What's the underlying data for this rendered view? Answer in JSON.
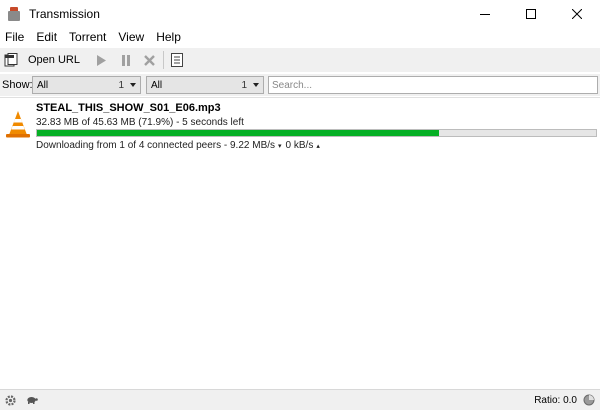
{
  "window": {
    "title": "Transmission",
    "icon": "transmission-app-icon"
  },
  "menu": [
    "File",
    "Edit",
    "Torrent",
    "View",
    "Help"
  ],
  "toolbar": {
    "open_url_label": "Open URL",
    "icons": [
      "open-icon",
      "start-icon",
      "pause-icon",
      "remove-icon",
      "properties-icon"
    ]
  },
  "filter": {
    "show_label": "Show:",
    "activity": {
      "value": "All",
      "count": "1"
    },
    "tracker": {
      "value": "All",
      "count": "1"
    },
    "search_placeholder": "Search..."
  },
  "torrents": [
    {
      "name": "STEAL_THIS_SHOW_S01_E06.mp3",
      "progress_text": "32.83 MB of 45.63 MB (71.9%) - 5 seconds left",
      "progress_percent": 71.9,
      "status": {
        "text": "Downloading from 1 of 4 connected peers - 9.22 MB/s",
        "down_arrow": "▾",
        "up_speed": "0 kB/s",
        "up_arrow": "▴"
      },
      "icon": "vlc-cone-icon"
    }
  ],
  "statusbar": {
    "ratio": "Ratio: 0.0"
  },
  "colors": {
    "progress": "#06b025",
    "toolbar_bg": "#f0f0f0"
  }
}
